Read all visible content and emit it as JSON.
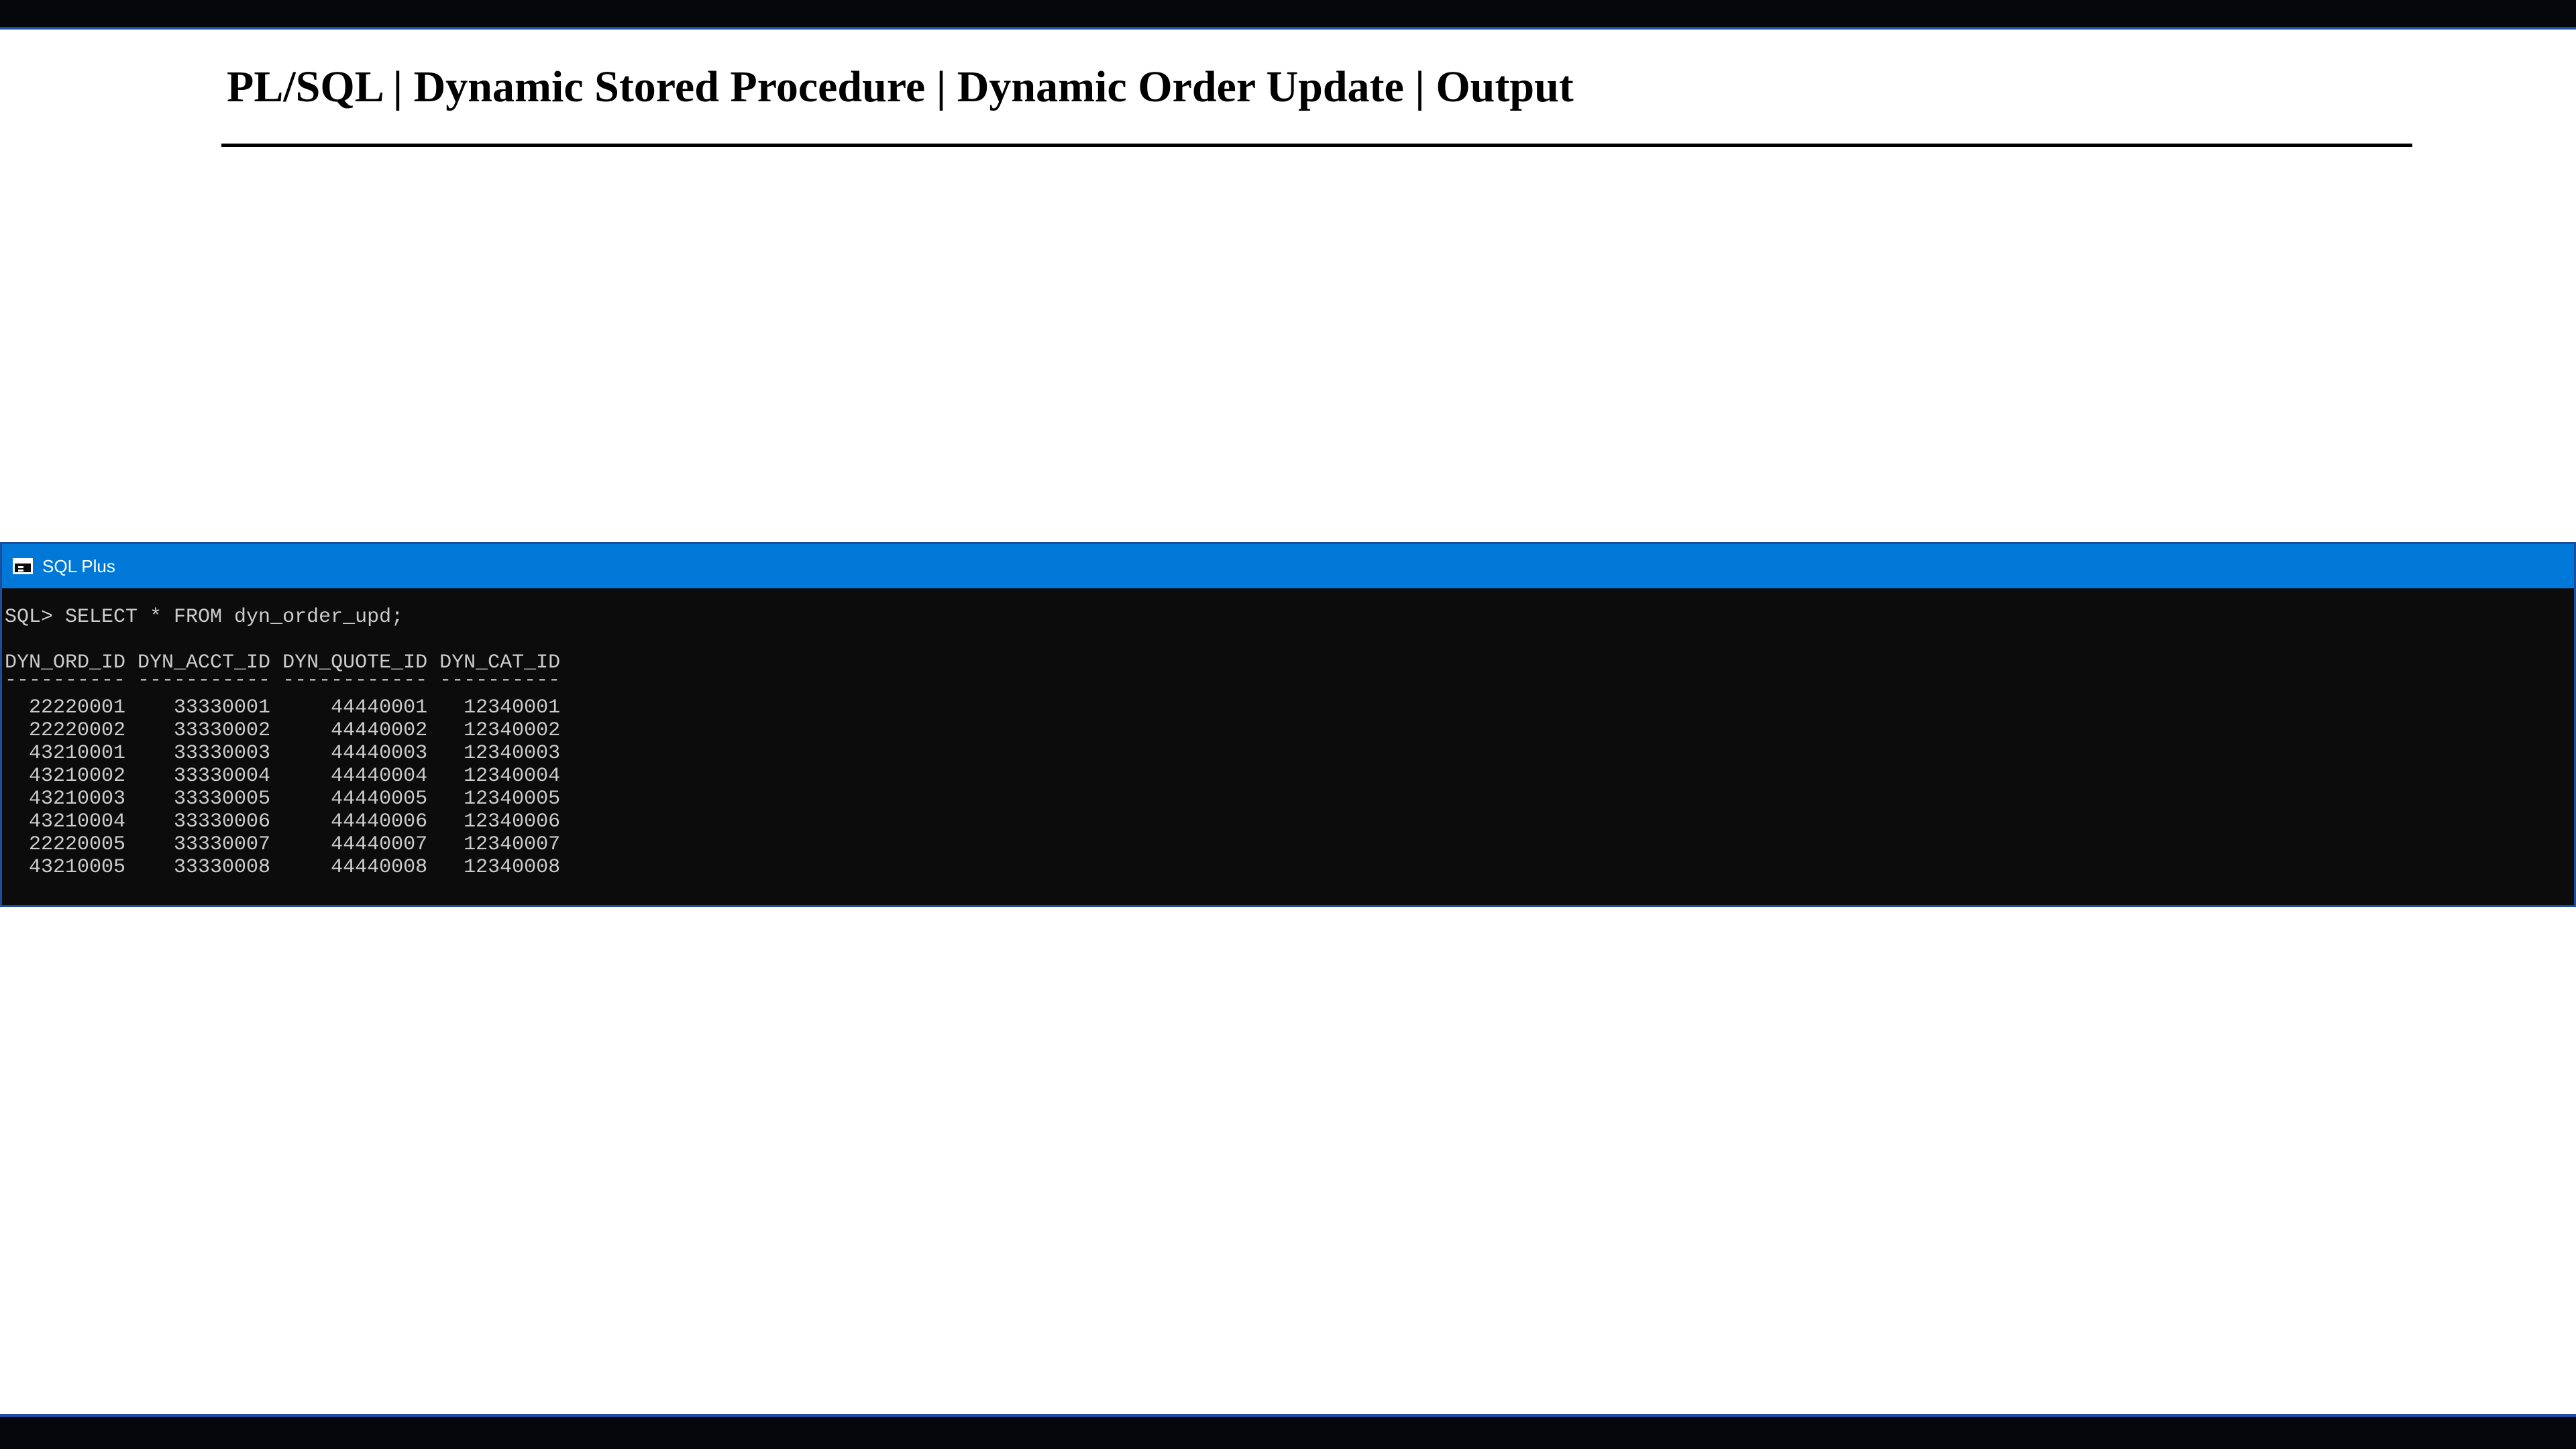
{
  "slide": {
    "title": "PL/SQL | Dynamic Stored Procedure | Dynamic Order Update | Output"
  },
  "window": {
    "title": "SQL Plus",
    "icon": "console-window-icon",
    "titlebar_color": "#0078d7",
    "background_color": "#0c0c0c",
    "text_color": "#cccccc"
  },
  "console": {
    "command": "SQL> SELECT * FROM dyn_order_upd;",
    "header": "DYN_ORD_ID DYN_ACCT_ID DYN_QUOTE_ID DYN_CAT_ID",
    "separator": "---------- ----------- ------------ ----------",
    "columns": [
      "DYN_ORD_ID",
      "DYN_ACCT_ID",
      "DYN_QUOTE_ID",
      "DYN_CAT_ID"
    ],
    "rows": [
      "  22220001    33330001     44440001   12340001",
      "  22220002    33330002     44440002   12340002",
      "  43210001    33330003     44440003   12340003",
      "  43210002    33330004     44440004   12340004",
      "  43210003    33330005     44440005   12340005",
      "  43210004    33330006     44440006   12340006",
      "  22220005    33330007     44440007   12340007",
      "  43210005    33330008     44440008   12340008"
    ]
  }
}
